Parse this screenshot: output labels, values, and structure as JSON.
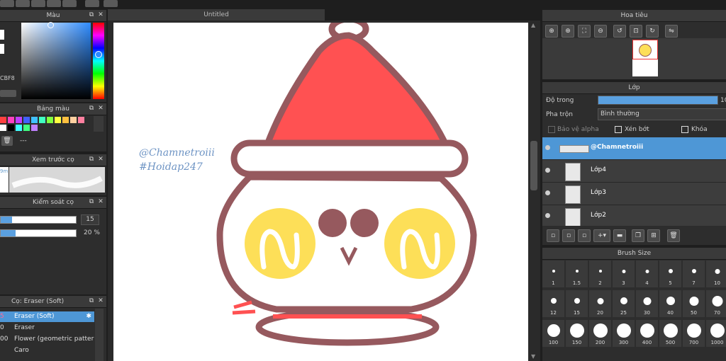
{
  "colors": {
    "accent": "#4e97d6",
    "canvas_bg": "#ffffff",
    "panel_bg": "#2d2d2d"
  },
  "color_panel": {
    "title": "Màu",
    "hex_value": "CBF8"
  },
  "palette_panel": {
    "title": "Bảng màu",
    "dash": "---",
    "swatches": [
      "#ff4040",
      "#ff40c0",
      "#c040ff",
      "#4060ff",
      "#40c0ff",
      "#40ffc0",
      "#80ff40",
      "#ffff40",
      "#ffc040",
      "#ffd0a0",
      "#ff80a0",
      "#ffffff",
      "#000000",
      "#40ffff",
      "#40ff80",
      "#c080ff"
    ]
  },
  "brush_preview_panel": {
    "title": "Xem trước cọ",
    "text_fragment": "9m"
  },
  "brush_control_panel": {
    "title": "Kiểm soát cọ",
    "size_value": "15",
    "opacity_value": "20 %",
    "size_level": 0.15,
    "opacity_level": 0.2
  },
  "brush_list_panel": {
    "title": "Cọ: Eraser (Soft)",
    "items": [
      {
        "num": "5",
        "name": "Eraser (Soft)",
        "selected": true
      },
      {
        "num": "0",
        "name": "Eraser",
        "selected": false
      },
      {
        "num": "00",
        "name": "Flower (geometric patter",
        "selected": false
      },
      {
        "num": "",
        "name": "Caro",
        "selected": false
      }
    ]
  },
  "document": {
    "tab_title": "Untitled",
    "watermark_line1": "@Chamnetroiii",
    "watermark_line2": "#Hoidap247"
  },
  "navigator_panel": {
    "title": "Hoa tiêu",
    "icons": [
      "zoom-in-icon",
      "zoom-in-icon",
      "fit-icon",
      "zoom-out-icon",
      "rotate-left-icon",
      "reset-icon",
      "rotate-right-icon",
      "flip-icon"
    ]
  },
  "layer_panel": {
    "title": "Lớp",
    "opacity_label": "Độ trong",
    "opacity_value": "10",
    "opacity_level": 1.0,
    "blend_label": "Pha trộn",
    "blend_value": "Bình thường",
    "protect_alpha": "Bảo vệ alpha",
    "clipping": "Xén bớt",
    "lock": "Khóa",
    "layers": [
      {
        "name": "@Chamnetroiii",
        "selected": true
      },
      {
        "name": "Lớp4",
        "selected": false
      },
      {
        "name": "Lớp3",
        "selected": false
      },
      {
        "name": "Lớp2",
        "selected": false
      }
    ]
  },
  "brush_size_panel": {
    "title": "Brush Size",
    "sizes": [
      "1",
      "1.5",
      "2",
      "3",
      "4",
      "5",
      "7",
      "10",
      "12",
      "15",
      "20",
      "25",
      "30",
      "40",
      "50",
      "70",
      "100",
      "150",
      "200",
      "300",
      "400",
      "500",
      "700",
      "1000"
    ]
  }
}
